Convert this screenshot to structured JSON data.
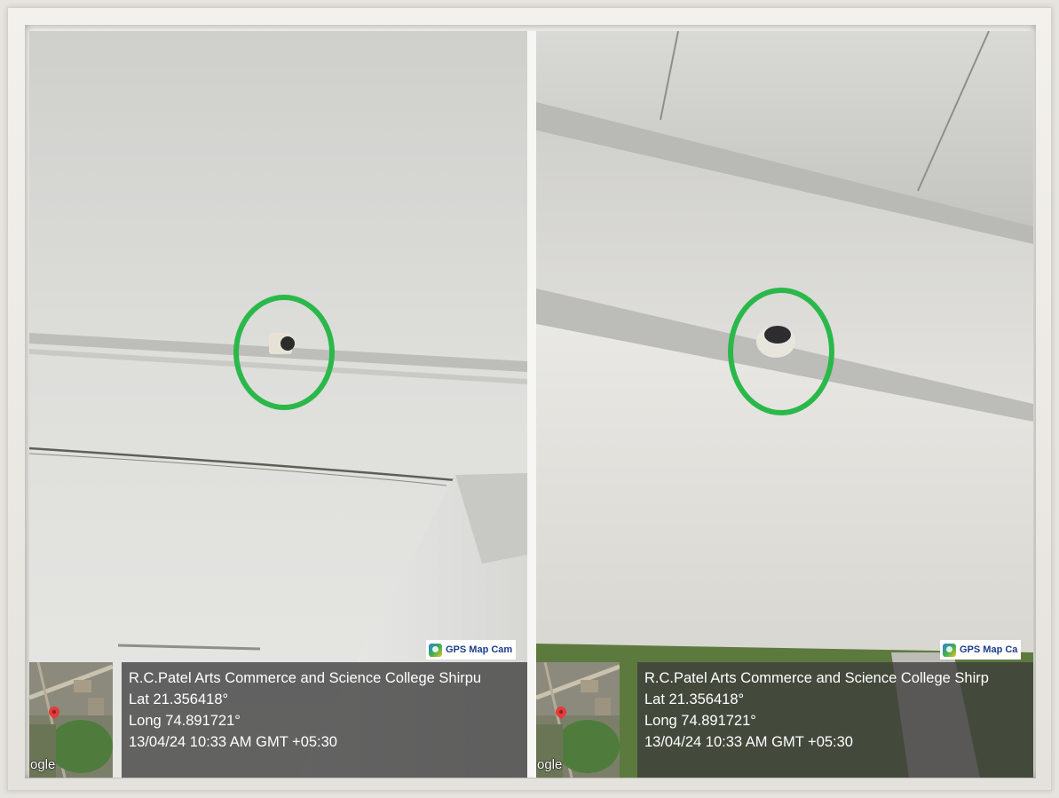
{
  "panels": [
    {
      "id": "left",
      "watermark": "GPS Map Cam",
      "google_mark": "ogle",
      "location": "R.C.Patel Arts Commerce and Science College Shirpu",
      "lat": "Lat 21.356418°",
      "long": "Long 74.891721°",
      "datetime": "13/04/24 10:33 AM GMT +05:30"
    },
    {
      "id": "right",
      "watermark": "GPS Map Ca",
      "google_mark": "ogle",
      "location": "R.C.Patel Arts Commerce and Science College Shirp",
      "lat": "Lat 21.356418°",
      "long": "Long 74.891721°",
      "datetime": "13/04/24 10:33 AM GMT +05:30"
    }
  ],
  "colors": {
    "highlight_ring": "#2bb84a",
    "info_overlay": "#3c3c3c",
    "watermark_text": "#1d3d8a"
  },
  "icons": [
    "gps-map-cam-icon",
    "map-pin-icon"
  ]
}
